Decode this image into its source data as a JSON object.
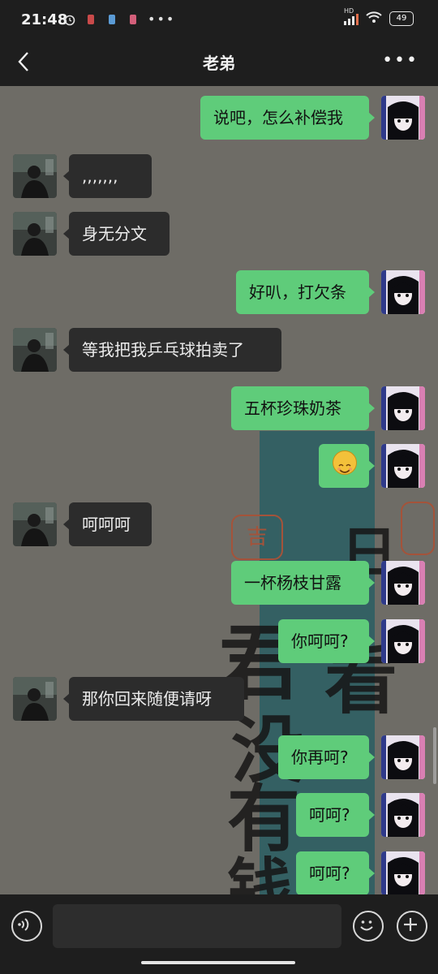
{
  "status_bar": {
    "time": "21:48",
    "network_badge": "HD",
    "battery": "49"
  },
  "nav": {
    "title": "老弟"
  },
  "messages": [
    {
      "side": "out",
      "text": "说吧，怎么补偿我"
    },
    {
      "side": "in",
      "text": ",,,,,,,"
    },
    {
      "side": "in",
      "text": "身无分文"
    },
    {
      "side": "out",
      "text": "好叭，打欠条"
    },
    {
      "side": "in",
      "text": "等我把我乒乓球拍卖了"
    },
    {
      "side": "out",
      "text": "五杯珍珠奶茶"
    },
    {
      "side": "out",
      "text": "",
      "emoji": "grinning-face-emoji"
    },
    {
      "side": "in",
      "text": "呵呵呵"
    },
    {
      "side": "out",
      "text": "一杯杨枝甘露"
    },
    {
      "side": "out",
      "text": "你呵呵?"
    },
    {
      "side": "in",
      "text": "那你回来随便请呀"
    },
    {
      "side": "out",
      "text": "你再呵?"
    },
    {
      "side": "out",
      "text": "呵呵?"
    },
    {
      "side": "out",
      "text": "呵呵?"
    }
  ],
  "background": {
    "glyphs": [
      "日",
      "看",
      "君",
      "没",
      "有",
      "钱"
    ],
    "seal_text": "吉"
  },
  "composer": {
    "input_value": ""
  },
  "colors": {
    "outgoing_bubble": "#5fcc7a",
    "incoming_bubble": "#2c2c2c",
    "bar_bg": "#1e1e1e"
  }
}
